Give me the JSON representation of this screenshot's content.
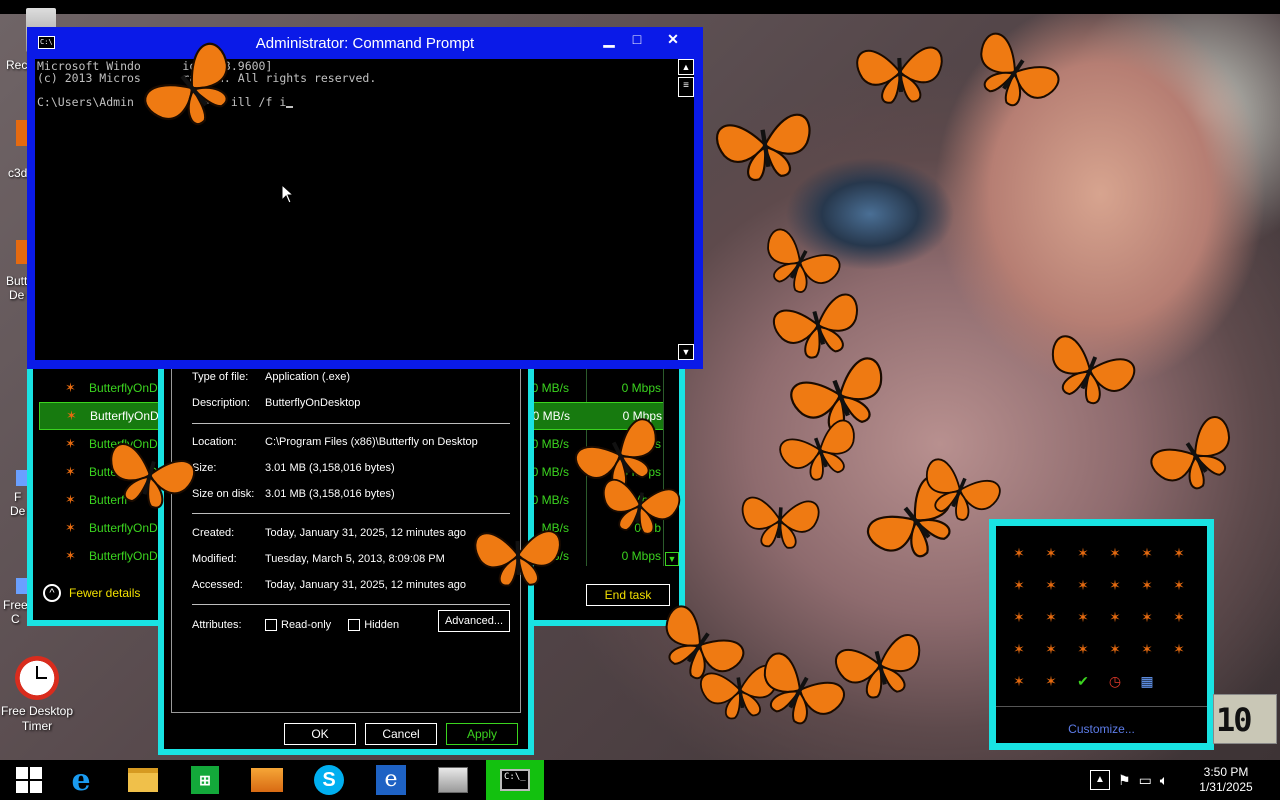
{
  "colors": {
    "window_border": "#19e3e3",
    "cmd_titlebar": "#0a1ae8",
    "highlight_green": "#3bd41f",
    "yellow_text": "#f2e000",
    "butterfly_orange": "#e56a10"
  },
  "desktop_icons": [
    {
      "label": "Rec",
      "icon": "recycle-bin-icon"
    },
    {
      "label": "c3d",
      "icon": "shortcut-icon"
    },
    {
      "label": "Butt\nDe",
      "icon": "butterfly-shortcut-icon"
    },
    {
      "label": "F\nDe",
      "icon": "shortcut-icon"
    },
    {
      "label": "Free\nC",
      "icon": "shortcut-icon"
    },
    {
      "label": "Free Desktop\nTimer",
      "icon": "desktop-timer-icon"
    }
  ],
  "cmd": {
    "title": "Administrator: Command Prompt",
    "lines": [
      "Microsoft Windo      ion 6.3.9600]",
      "(c) 2013 Micros      ration. All rights reserved.",
      "",
      "C:\\Users\\Admin      ator>   ill /f i"
    ],
    "min_label": "▁",
    "max_label": "□",
    "close_label": "✕"
  },
  "taskmgr": {
    "rows": [
      {
        "name": "ButterflyOnDe",
        "disk": "0 MB/s",
        "net": "0 Mbps",
        "selected": false
      },
      {
        "name": "ButterflyOnDe",
        "disk": "0 MB/s",
        "net": "0 Mbps",
        "selected": true
      },
      {
        "name": "ButterflyOnDe",
        "disk": "0 MB/s",
        "net": "0 Mbps",
        "selected": false
      },
      {
        "name": "ButterflyOnDe",
        "disk": "0 MB/s",
        "net": "0 Mbps",
        "selected": false
      },
      {
        "name": "Butterfl",
        "disk": "0 MB/s",
        "net": "0 Mbps",
        "selected": false
      },
      {
        "name": "ButterflyOnDe",
        "disk": "MB/s",
        "net": "0 Mb",
        "selected": false
      },
      {
        "name": "ButterflyOnDe",
        "disk": "MB/s",
        "net": "0 Mbps",
        "selected": false
      }
    ],
    "fewer_details": "Fewer details",
    "end_task": "End task"
  },
  "props": {
    "type_label": "Type of file:",
    "type_value": "Application (.exe)",
    "desc_label": "Description:",
    "desc_value": "ButterflyOnDesktop",
    "loc_label": "Location:",
    "loc_value": "C:\\Program Files (x86)\\Butterfly on Desktop",
    "size_label": "Size:",
    "size_value": "3.01 MB (3,158,016 bytes)",
    "disk_label": "Size on disk:",
    "disk_value": "3.01 MB (3,158,016 bytes)",
    "created_label": "Created:",
    "created_value": "Today, January 31, 2025, 12 minutes ago",
    "modified_label": "Modified:",
    "modified_value": "Tuesday, March 5, 2013, 8:09:08 PM",
    "accessed_label": "Accessed:",
    "accessed_value": "Today, January 31, 2025, 12 minutes ago",
    "attributes_label": "Attributes:",
    "readonly_label": "Read-only",
    "hidden_label": "Hidden",
    "advanced_label": "Advanced...",
    "ok_label": "OK",
    "cancel_label": "Cancel",
    "apply_label": "Apply"
  },
  "tray_flyout": {
    "icons": [
      "butterfly",
      "butterfly",
      "butterfly",
      "butterfly",
      "butterfly",
      "butterfly",
      "butterfly",
      "butterfly",
      "butterfly",
      "butterfly",
      "butterfly",
      "butterfly",
      "butterfly",
      "butterfly",
      "butterfly",
      "butterfly",
      "butterfly",
      "butterfly",
      "butterfly",
      "butterfly",
      "butterfly",
      "butterfly",
      "butterfly",
      "butterfly",
      "butterfly",
      "butterfly",
      "shield-check",
      "alarm-clock",
      "calculator"
    ],
    "customize_label": "Customize..."
  },
  "gadget": {
    "digits": "10"
  },
  "taskbar": {
    "apps": [
      "start",
      "internet-explorer",
      "file-explorer",
      "store",
      "package",
      "skype",
      "internet-explorer-2",
      "resource-monitor",
      "command-prompt"
    ],
    "active": "command-prompt",
    "time": "3:50 PM",
    "date": "1/31/2025"
  }
}
